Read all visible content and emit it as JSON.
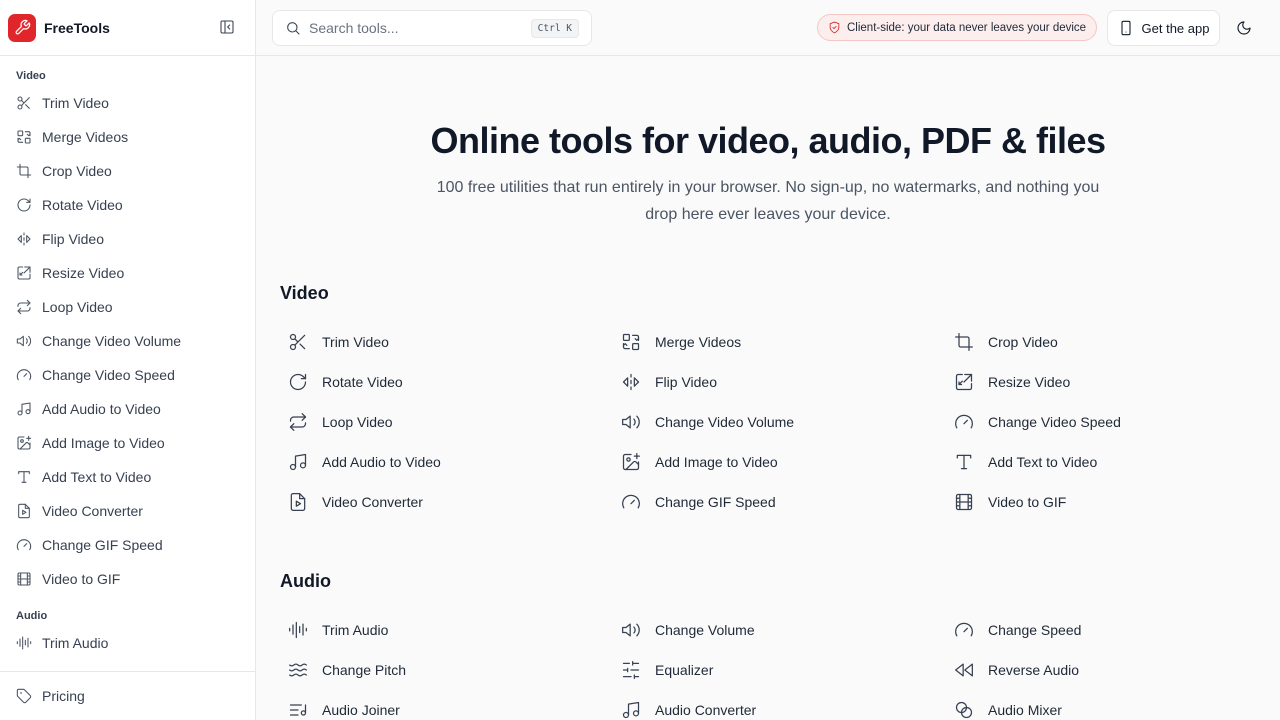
{
  "brand": {
    "name": "FreeTools",
    "logo_icon": "wrench-icon",
    "accent": "#e0262b"
  },
  "search": {
    "placeholder": "Search tools...",
    "value": "",
    "shortcut": "Ctrl K"
  },
  "topbar": {
    "privacy_text": "Client-side: your data never leaves your device",
    "get_app_label": "Get the app",
    "theme_icon": "moon-icon"
  },
  "sidebar": {
    "sections": [
      {
        "title": "Video",
        "items": [
          {
            "label": "Trim Video",
            "icon": "scissors"
          },
          {
            "label": "Merge Videos",
            "icon": "merge"
          },
          {
            "label": "Crop Video",
            "icon": "crop"
          },
          {
            "label": "Rotate Video",
            "icon": "rotate"
          },
          {
            "label": "Flip Video",
            "icon": "flip"
          },
          {
            "label": "Resize Video",
            "icon": "resize"
          },
          {
            "label": "Loop Video",
            "icon": "loop"
          },
          {
            "label": "Change Video Volume",
            "icon": "volume"
          },
          {
            "label": "Change Video Speed",
            "icon": "gauge"
          },
          {
            "label": "Add Audio to Video",
            "icon": "music"
          },
          {
            "label": "Add Image to Video",
            "icon": "image-plus"
          },
          {
            "label": "Add Text to Video",
            "icon": "type"
          },
          {
            "label": "Video Converter",
            "icon": "file-video"
          },
          {
            "label": "Change GIF Speed",
            "icon": "gauge"
          },
          {
            "label": "Video to GIF",
            "icon": "film"
          }
        ]
      },
      {
        "title": "Audio",
        "items": [
          {
            "label": "Trim Audio",
            "icon": "audio-lines"
          }
        ]
      }
    ],
    "footer": {
      "label": "Pricing",
      "icon": "tag"
    }
  },
  "hero": {
    "title": "Online tools for video, audio, PDF & files",
    "subtitle": "100 free utilities that run entirely in your browser. No sign-up, no watermarks, and nothing you drop here ever leaves your device."
  },
  "categories": [
    {
      "title": "Video",
      "tools": [
        {
          "label": "Trim Video",
          "icon": "scissors"
        },
        {
          "label": "Merge Videos",
          "icon": "merge"
        },
        {
          "label": "Crop Video",
          "icon": "crop"
        },
        {
          "label": "Rotate Video",
          "icon": "rotate"
        },
        {
          "label": "Flip Video",
          "icon": "flip"
        },
        {
          "label": "Resize Video",
          "icon": "resize"
        },
        {
          "label": "Loop Video",
          "icon": "loop"
        },
        {
          "label": "Change Video Volume",
          "icon": "volume"
        },
        {
          "label": "Change Video Speed",
          "icon": "gauge"
        },
        {
          "label": "Add Audio to Video",
          "icon": "music"
        },
        {
          "label": "Add Image to Video",
          "icon": "image-plus"
        },
        {
          "label": "Add Text to Video",
          "icon": "type"
        },
        {
          "label": "Video Converter",
          "icon": "file-video"
        },
        {
          "label": "Change GIF Speed",
          "icon": "gauge"
        },
        {
          "label": "Video to GIF",
          "icon": "film"
        }
      ]
    },
    {
      "title": "Audio",
      "tools": [
        {
          "label": "Trim Audio",
          "icon": "audio-lines"
        },
        {
          "label": "Change Volume",
          "icon": "volume"
        },
        {
          "label": "Change Speed",
          "icon": "gauge"
        },
        {
          "label": "Change Pitch",
          "icon": "waves"
        },
        {
          "label": "Equalizer",
          "icon": "sliders"
        },
        {
          "label": "Reverse Audio",
          "icon": "rewind"
        },
        {
          "label": "Audio Joiner",
          "icon": "list-music"
        },
        {
          "label": "Audio Converter",
          "icon": "music"
        },
        {
          "label": "Audio Mixer",
          "icon": "circles"
        }
      ]
    }
  ]
}
